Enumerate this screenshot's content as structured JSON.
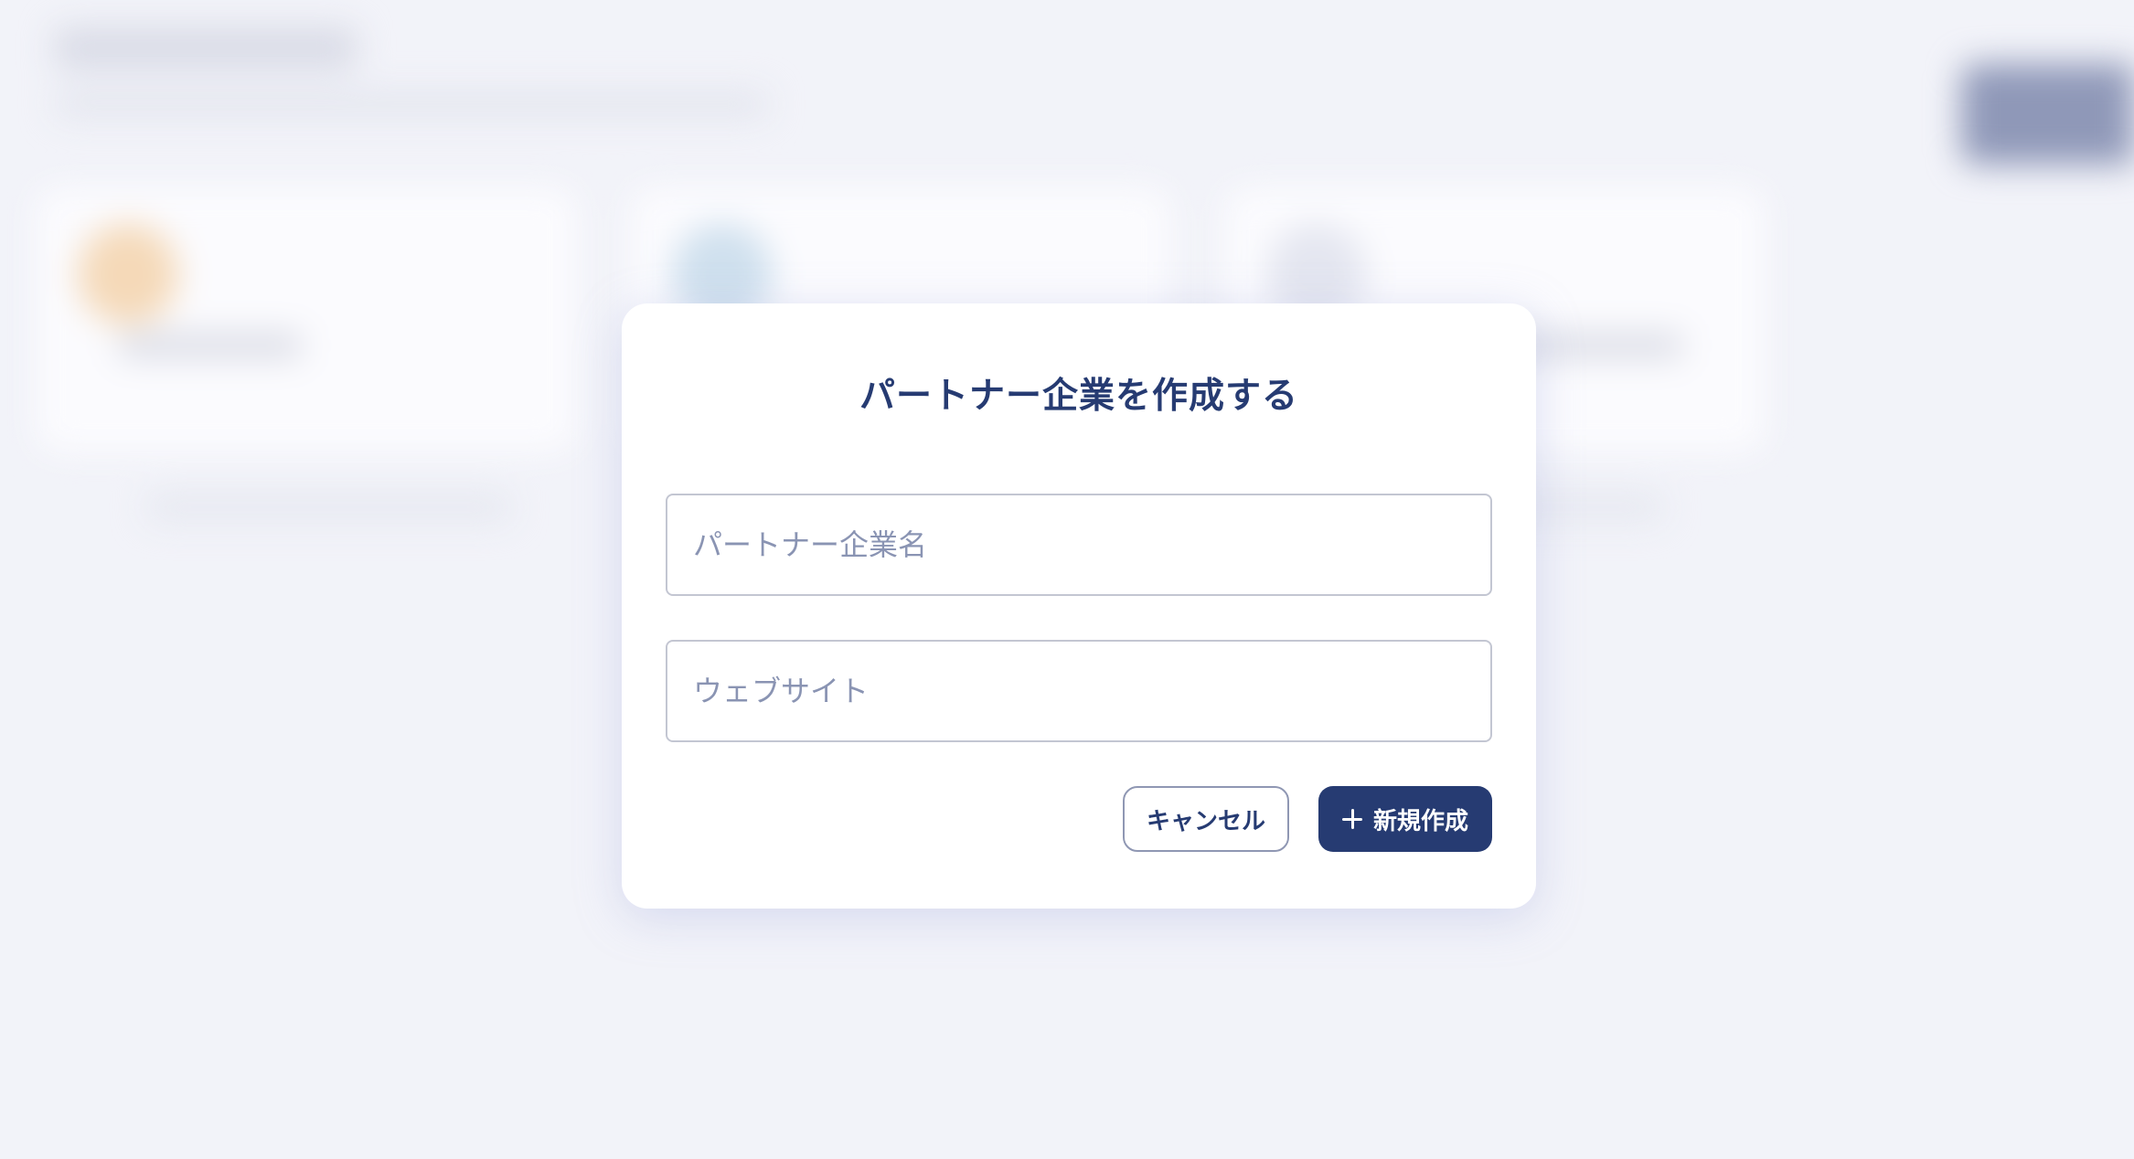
{
  "modal": {
    "title": "パートナー企業を作成する",
    "fields": {
      "company_name_placeholder": "パートナー企業名",
      "company_name_value": "",
      "website_placeholder": "ウェブサイト",
      "website_value": ""
    },
    "buttons": {
      "cancel_label": "キャンセル",
      "create_label": "新規作成",
      "create_icon": "plus-icon"
    }
  },
  "colors": {
    "primary": "#263b72",
    "background": "#f2f3f9",
    "placeholder": "#8a94b3"
  }
}
